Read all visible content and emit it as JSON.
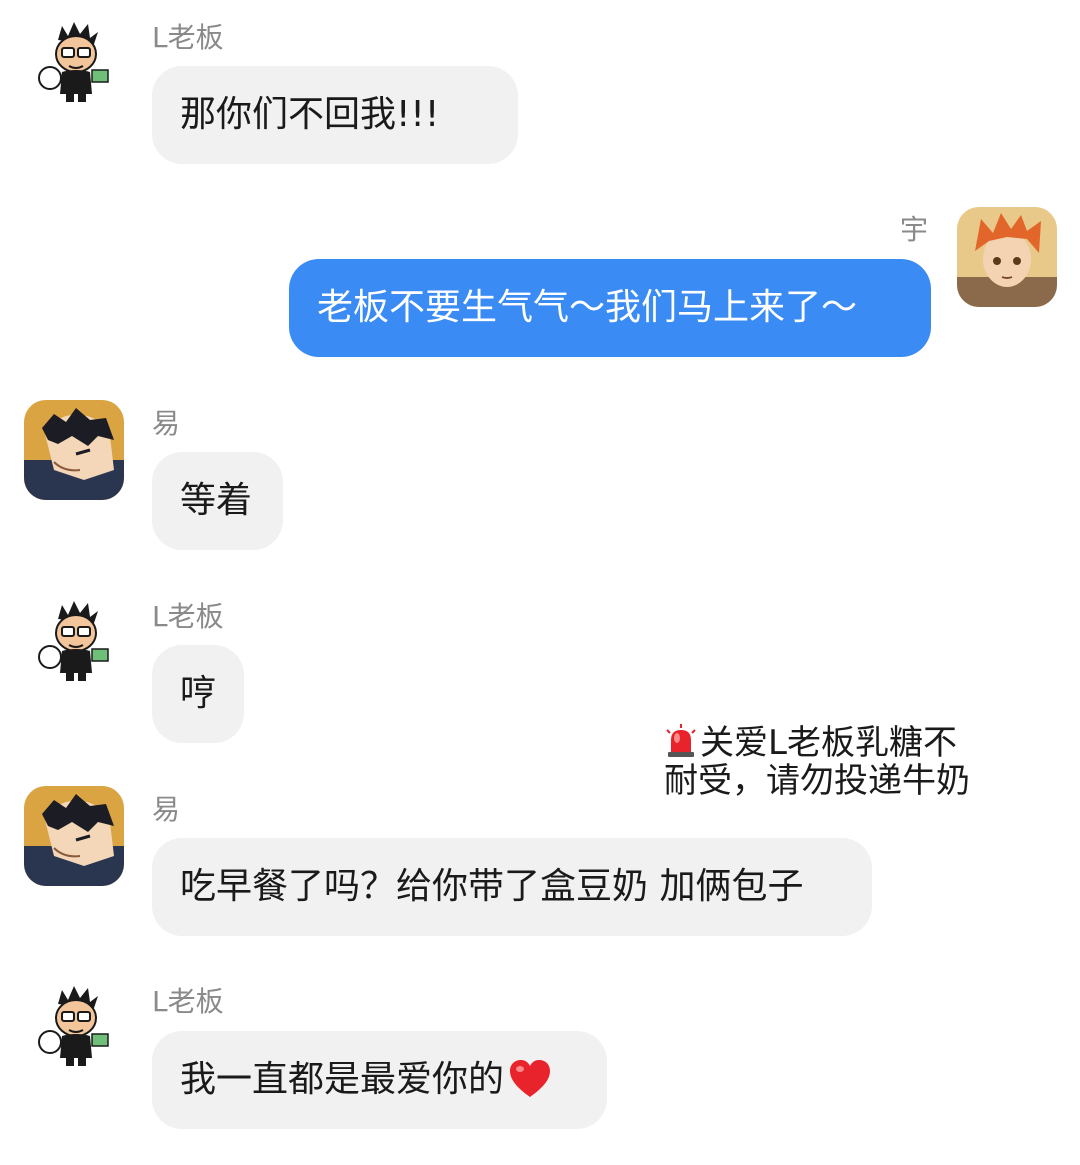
{
  "conversation": {
    "messages": [
      {
        "sender": "L老板",
        "text": "那你们不回我!!!",
        "direction": "received",
        "avatar": "cartoon-boss-avatar"
      },
      {
        "sender": "宇",
        "text": "老板不要生气气～我们马上来了～",
        "direction": "sent",
        "avatar": "orange-hair-anime-avatar"
      },
      {
        "sender": "易",
        "text": "等着",
        "direction": "received",
        "avatar": "dark-hair-anime-avatar"
      },
      {
        "sender": "L老板",
        "text": "哼",
        "direction": "received",
        "avatar": "cartoon-boss-avatar"
      },
      {
        "sender": "易",
        "text": "吃早餐了吗？给你带了盒豆奶 加俩包子",
        "direction": "received",
        "avatar": "dark-hair-anime-avatar"
      },
      {
        "sender": "L老板",
        "text": "我一直都是最爱你的",
        "direction": "received",
        "avatar": "cartoon-boss-avatar",
        "trailing_icon": "red-heart-icon"
      }
    ]
  },
  "overlay_notice": {
    "icon": "siren-icon",
    "line1": "关爱L老板乳糖不",
    "line2": "耐受，请勿投递牛奶"
  },
  "colors": {
    "sent_bubble": "#3b8bf5",
    "received_bubble": "#f1f1f1",
    "sender_name": "#8a8a8a",
    "heart": "#e8232c"
  }
}
